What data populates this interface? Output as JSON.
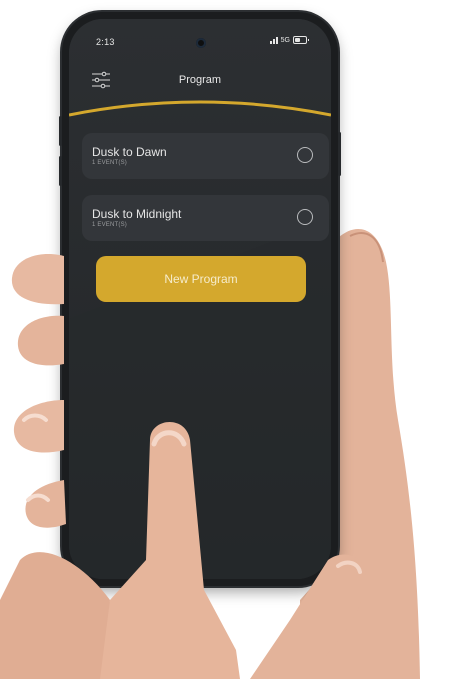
{
  "status_bar": {
    "time": "2:13",
    "network": "5G",
    "icons": [
      "signal-icon",
      "battery-icon",
      "front-camera-icon"
    ]
  },
  "header": {
    "title": "Program",
    "menu_icon": "settings-sliders-icon"
  },
  "programs": [
    {
      "name": "Dusk to Dawn",
      "events": "1 EVENT(S)",
      "selected": false
    },
    {
      "name": "Dusk to Midnight",
      "events": "1 EVENT(S)",
      "selected": false
    }
  ],
  "actions": {
    "new_program_label": "New Program"
  },
  "colors": {
    "accent": "#d4a82d",
    "screen_background": "#2a2d30",
    "card_background": "#33363a",
    "text_primary": "#e6e6e6",
    "text_secondary": "#9a9c9e"
  }
}
